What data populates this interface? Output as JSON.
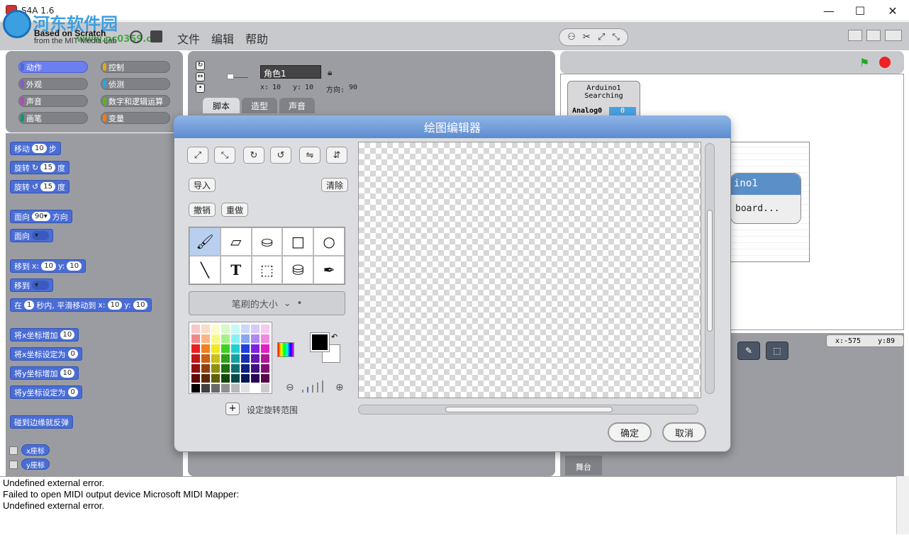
{
  "window": {
    "title": "S4A 1.6",
    "minimize": "—",
    "maximize": "☐",
    "close": "✕"
  },
  "watermark": {
    "text": "河东软件园",
    "url": "www.pc0359.cn"
  },
  "header": {
    "brand_line1": "Based on Scratch",
    "brand_line2": "from the MIT Media Lab"
  },
  "menu": [
    "文件",
    "编辑",
    "帮助"
  ],
  "categories": [
    {
      "label": "动作",
      "color": "#4a6cd4",
      "selected": true
    },
    {
      "label": "控制",
      "color": "#e1a91a"
    },
    {
      "label": "外观",
      "color": "#8a55d7"
    },
    {
      "label": "侦测",
      "color": "#2ca5e2"
    },
    {
      "label": "声音",
      "color": "#bb42c3"
    },
    {
      "label": "数字和逻辑运算",
      "color": "#5cb712"
    },
    {
      "label": "画笔",
      "color": "#0e9a6c"
    },
    {
      "label": "变量",
      "color": "#ee7d16"
    }
  ],
  "blocks": {
    "move": [
      "移动",
      "10",
      "步"
    ],
    "turn_cw": [
      "旋转",
      "15",
      "度"
    ],
    "turn_ccw": [
      "旋转",
      "15",
      "度"
    ],
    "point_dir": [
      "面向",
      "90▾",
      "方向"
    ],
    "point_to": "面向",
    "goto_xy": [
      "移到",
      "x:",
      "10",
      "y:",
      "10"
    ],
    "goto": "移到",
    "glide": [
      "在",
      "1",
      "秒内, 平滑移动到",
      "x:",
      "10",
      "y:",
      "10"
    ],
    "change_x": [
      "将x坐标增加",
      "10"
    ],
    "set_x": [
      "将x坐标设定为",
      "0"
    ],
    "change_y": [
      "将y坐标增加",
      "10"
    ],
    "set_y": [
      "将y坐标设定为",
      "0"
    ],
    "bounce": "碰到边缘就反弹",
    "x_pos": "x座标",
    "y_pos": "y座标"
  },
  "sprite": {
    "name": "角色1",
    "x_label": "x:",
    "x": "10",
    "y_label": "y:",
    "y": "10",
    "dir_label": "方向:",
    "dir": "90"
  },
  "tabs": [
    "脚本",
    "造型",
    "声音"
  ],
  "stage": {
    "arduino_title": "Arduino1",
    "arduino_status": "Searching",
    "analog_label": "Analog0",
    "analog_value": "0",
    "pill_title": "ino1",
    "pill_body": "board...",
    "x_readout": "x:-575",
    "y_readout": "y:89",
    "stage_tab": "舞台"
  },
  "paint_editor": {
    "title": "绘图编辑器",
    "import": "导入",
    "clear": "清除",
    "undo": "撤销",
    "redo": "重做",
    "brush_size": "笔刷的大小",
    "rotation_center": "设定旋转范围",
    "ok": "确定",
    "cancel": "取消",
    "tools": [
      "brush",
      "eraser",
      "fill",
      "rectangle",
      "ellipse",
      "line",
      "text",
      "select",
      "stamp",
      "eyedropper"
    ],
    "text_tool_glyph": "T"
  },
  "console": [
    "Undefined external error.",
    "Failed to open MIDI output device Microsoft MIDI Mapper:",
    "Undefined external error."
  ]
}
